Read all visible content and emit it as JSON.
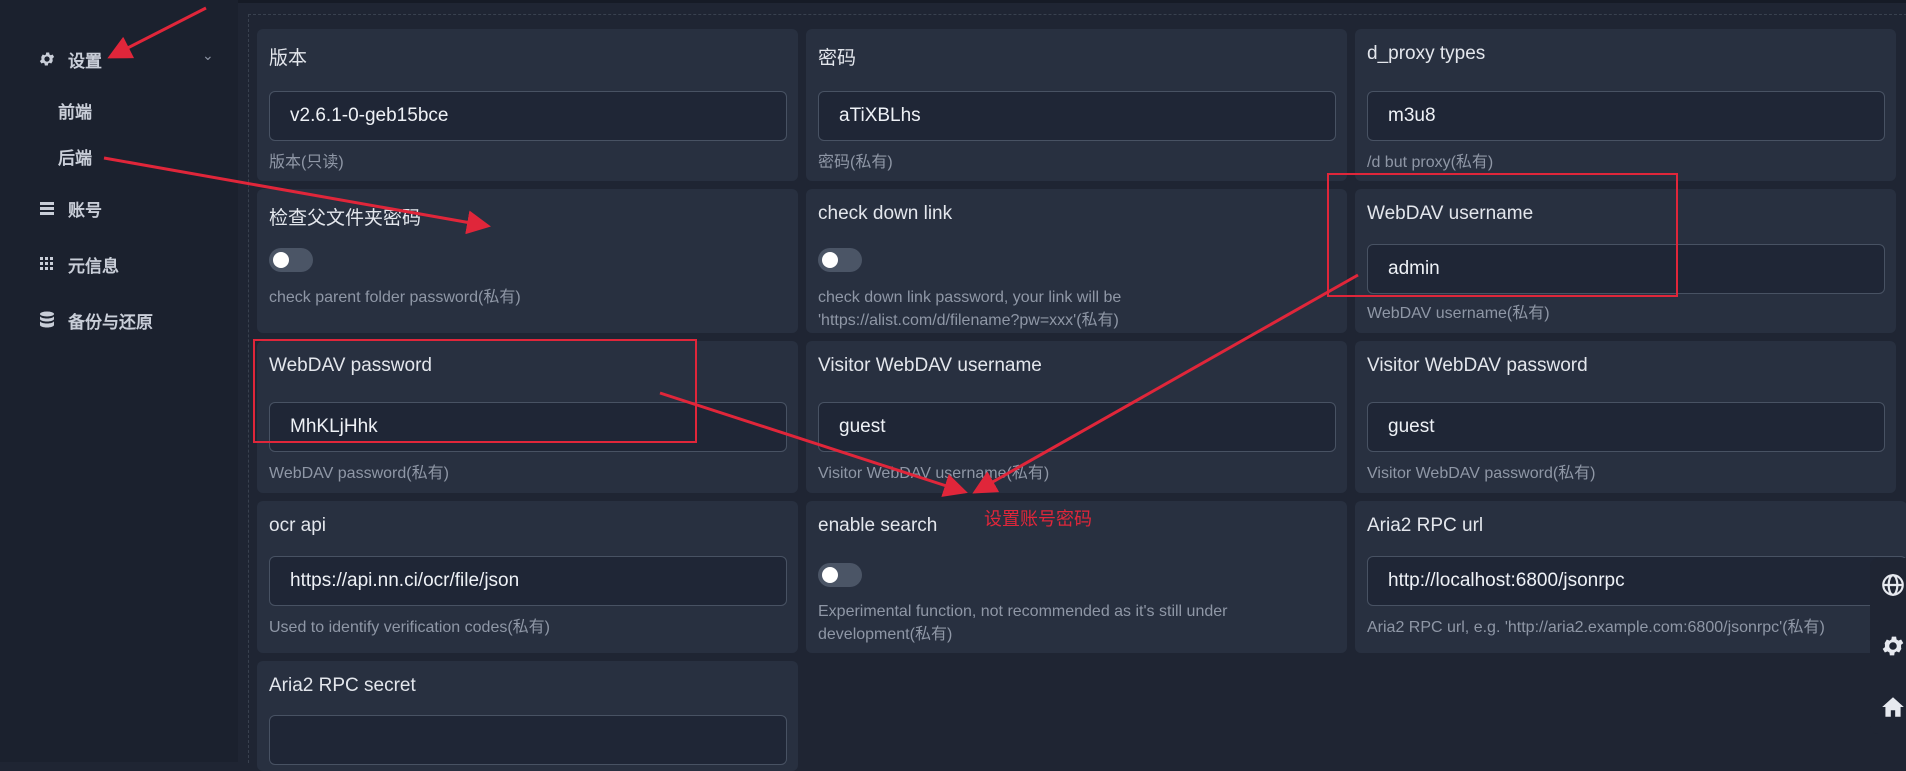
{
  "sidebar": {
    "settings_label": "设置",
    "sub_items": [
      "前端",
      "后端"
    ],
    "items": [
      {
        "label": "账号",
        "icon": "list-icon"
      },
      {
        "label": "元信息",
        "icon": "grid-icon"
      },
      {
        "label": "备份与还原",
        "icon": "database-icon"
      }
    ]
  },
  "settings": [
    {
      "label": "版本",
      "value": "v2.6.1-0-geb15bce",
      "help": "版本(只读)"
    },
    {
      "label": "密码",
      "value": "aTiXBLhs",
      "help": "密码(私有)"
    },
    {
      "label": "d_proxy types",
      "value": "m3u8",
      "help": "/d but proxy(私有)"
    },
    {
      "label": "检查父文件夹密码",
      "toggle": false,
      "help": "check parent folder password(私有)"
    },
    {
      "label": "check down link",
      "toggle": false,
      "help": "check down link password, your link will be 'https://alist.com/d/filename?pw=xxx'(私有)"
    },
    {
      "label": "WebDAV username",
      "value": "admin",
      "help": "WebDAV username(私有)"
    },
    {
      "label": "WebDAV password",
      "value": "MhKLjHhk",
      "help": "WebDAV password(私有)"
    },
    {
      "label": "Visitor WebDAV username",
      "value": "guest",
      "help": "Visitor WebDAV username(私有)"
    },
    {
      "label": "Visitor WebDAV password",
      "value": "guest",
      "help": "Visitor WebDAV password(私有)"
    },
    {
      "label": "ocr api",
      "value": "https://api.nn.ci/ocr/file/json",
      "help": "Used to identify verification codes(私有)"
    },
    {
      "label": "enable search",
      "toggle": false,
      "help": "Experimental function, not recommended as it's still under development(私有)"
    },
    {
      "label": "Aria2 RPC url",
      "value": "http://localhost:6800/jsonrpc",
      "help": "Aria2 RPC url, e.g. 'http://aria2.example.com:6800/jsonrpc'(私有)"
    },
    {
      "label": "Aria2 RPC secret",
      "value": ""
    }
  ],
  "annotation": {
    "text": "设置账号密码",
    "color": "#e0263a"
  },
  "float_buttons": [
    "globe-icon",
    "gear-icon",
    "home-icon"
  ]
}
